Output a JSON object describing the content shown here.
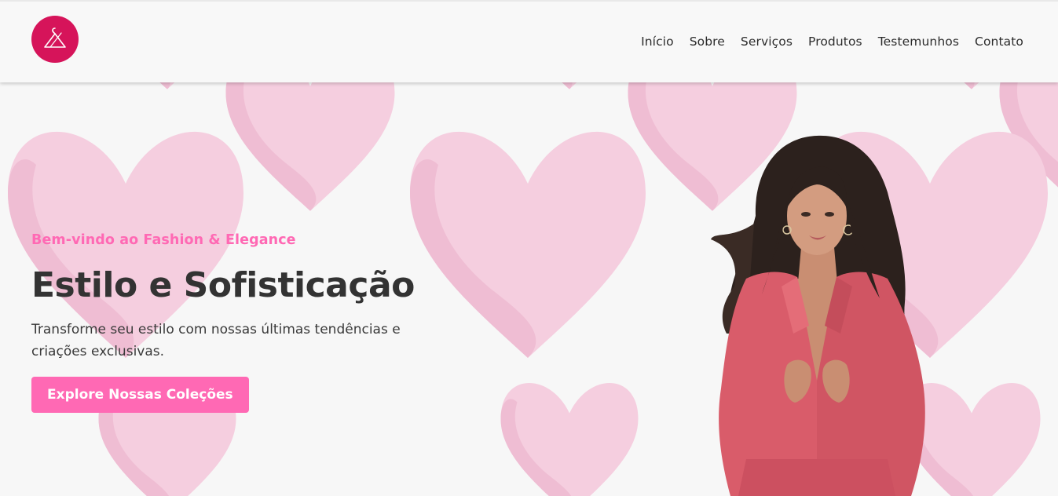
{
  "header": {
    "logo_icon": "hanger-logo-icon",
    "logo_color": "#d6145a",
    "nav": [
      {
        "label": "Início"
      },
      {
        "label": "Sobre"
      },
      {
        "label": "Serviços"
      },
      {
        "label": "Produtos"
      },
      {
        "label": "Testemunhos"
      },
      {
        "label": "Contato"
      }
    ]
  },
  "hero": {
    "tagline": "Bem-vindo ao Fashion & Elegance",
    "headline": "Estilo e Sofisticação",
    "subtitle": "Transforme seu estilo com nossas últimas tendências e criações exclusivas.",
    "cta_label": "Explore Nossas Coleções"
  },
  "colors": {
    "accent": "#ff69b4",
    "heart": "#f5cedf",
    "heart_shade": "#efbdd3",
    "background": "#f7f7f7",
    "text_dark": "#333333"
  }
}
